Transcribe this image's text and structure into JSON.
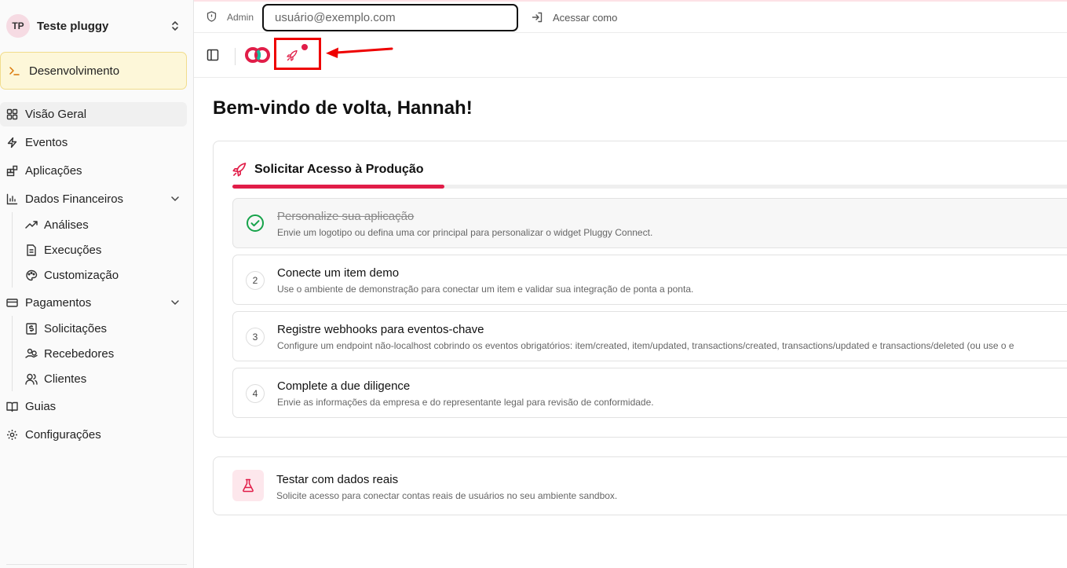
{
  "team": {
    "initials": "TP",
    "name": "Teste pluggy"
  },
  "environment": {
    "label": "Desenvolvimento"
  },
  "sidebar": {
    "items": [
      {
        "label": "Visão Geral",
        "icon": "grid-icon"
      },
      {
        "label": "Eventos",
        "icon": "zap-icon"
      },
      {
        "label": "Aplicações",
        "icon": "blocks-icon"
      },
      {
        "label": "Dados Financeiros",
        "icon": "bar-chart-icon"
      },
      {
        "label": "Análises",
        "icon": "trending-up-icon"
      },
      {
        "label": "Execuções",
        "icon": "file-text-icon"
      },
      {
        "label": "Customização",
        "icon": "palette-icon"
      },
      {
        "label": "Pagamentos",
        "icon": "credit-card-icon"
      },
      {
        "label": "Solicitações",
        "icon": "dollar-receipt-icon"
      },
      {
        "label": "Recebedores",
        "icon": "hand-coins-icon"
      },
      {
        "label": "Clientes",
        "icon": "users-icon"
      },
      {
        "label": "Guias",
        "icon": "book-icon"
      },
      {
        "label": "Configurações",
        "icon": "gear-icon"
      }
    ],
    "active": "Visão Geral"
  },
  "admin_bar": {
    "label": "Admin",
    "input_placeholder": "usuário@exemplo.com",
    "access_label": "Acessar como"
  },
  "colors": {
    "accent": "#e11d48",
    "highlight_box": "#ee0000"
  },
  "welcome": "Bem-vindo de volta, Hannah!",
  "production": {
    "title": "Solicitar Acesso à Produção",
    "progress": 0.25,
    "steps": [
      {
        "number": "",
        "title": "Personalize sua aplicação",
        "description": "Envie um logotipo ou defina uma cor principal para personalizar o widget Pluggy Connect.",
        "done": true
      },
      {
        "number": "2",
        "title": "Conecte um item demo",
        "description": "Use o ambiente de demonstração para conectar um item e validar sua integração de ponta a ponta.",
        "done": false
      },
      {
        "number": "3",
        "title": "Registre webhooks para eventos-chave",
        "description": "Configure um endpoint não-localhost cobrindo os eventos obrigatórios: item/created, item/updated, transactions/created, transactions/updated e transactions/deleted (ou use o e",
        "done": false
      },
      {
        "number": "4",
        "title": "Complete a due diligence",
        "description": "Envie as informações da empresa e do representante legal para revisão de conformidade.",
        "done": false
      }
    ]
  },
  "real_data": {
    "title": "Testar com dados reais",
    "description": "Solicite acesso para conectar contas reais de usuários no seu ambiente sandbox."
  }
}
